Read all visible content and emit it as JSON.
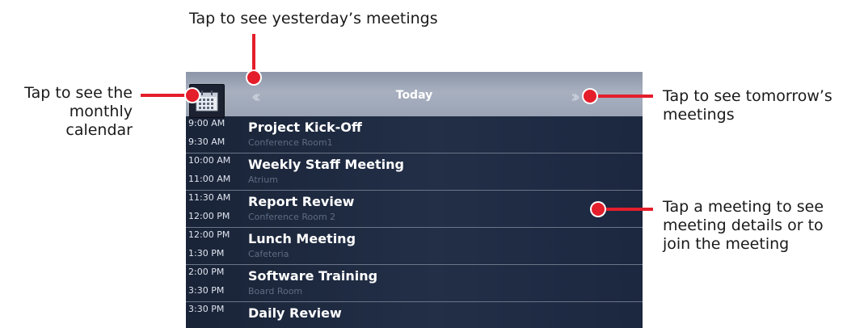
{
  "annotations": {
    "yesterday": "Tap to see yesterday’s meetings",
    "monthly_lines": [
      "Tap to see the",
      "monthly",
      "calendar"
    ],
    "tomorrow_lines": [
      "Tap to see tomorrow’s",
      "meetings"
    ],
    "meeting_lines": [
      "Tap a meeting to see",
      "meeting details or to",
      "join the meeting"
    ]
  },
  "header": {
    "title": "Today",
    "calendar_icon": "calendar-icon",
    "prev_icon": "double-chevron-left-icon",
    "next_icon": "double-chevron-right-icon"
  },
  "meetings": [
    {
      "start": "9:00 AM",
      "end": "9:30 AM",
      "title": "Project Kick-Off",
      "location": "Conference Room1"
    },
    {
      "start": "10:00 AM",
      "end": "11:00 AM",
      "title": "Weekly Staff Meeting",
      "location": "Atrium"
    },
    {
      "start": "11:30 AM",
      "end": "12:00 PM",
      "title": "Report Review",
      "location": "Conference Room 2"
    },
    {
      "start": "12:00 PM",
      "end": "1:30 PM",
      "title": "Lunch Meeting",
      "location": "Cafeteria"
    },
    {
      "start": "2:00 PM",
      "end": "3:30 PM",
      "title": "Software Training",
      "location": "Board Room"
    },
    {
      "start": "3:30 PM",
      "end": "",
      "title": "Daily Review",
      "location": ""
    }
  ],
  "colors": {
    "accent_red": "#e41e2b",
    "header_bg": "#a8b0c0",
    "list_bg": "#1a2438"
  }
}
